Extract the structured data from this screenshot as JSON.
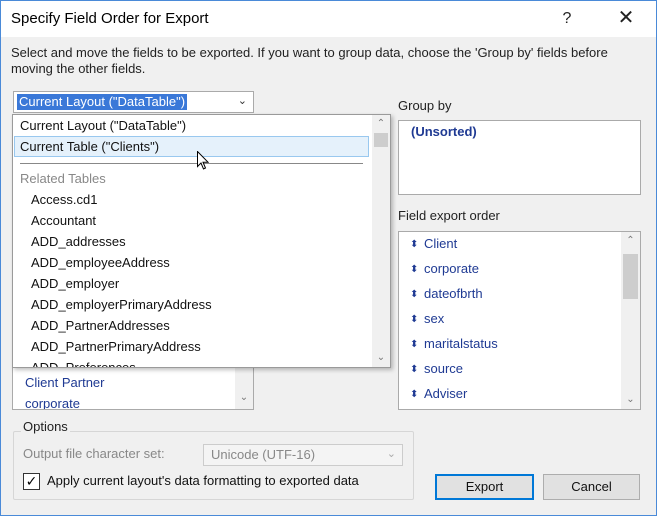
{
  "window": {
    "title": "Specify Field Order for Export",
    "help_label": "?",
    "close_label": "✕"
  },
  "instructions": "Select and move the fields to be exported. If you want to group data, choose the 'Group by' fields before moving the other fields.",
  "source_combo": {
    "value": "Current Layout (\"DataTable\")",
    "arrow": "⌄"
  },
  "dropdown": {
    "items": [
      "Current Layout (\"DataTable\")",
      "Current Table (\"Clients\")"
    ],
    "group_label": "Related Tables",
    "related_tables": [
      "Access.cd1",
      "Accountant",
      "ADD_addresses",
      "ADD_employeeAddress",
      "ADD_employer",
      "ADD_employerPrimaryAddress",
      "ADD_PartnerAddresses",
      "ADD_PartnerPrimaryAddress",
      "ADD_Preferences"
    ]
  },
  "fields_list": {
    "items": [
      "Client Partner",
      "corporate"
    ]
  },
  "group_by": {
    "label": "Group by",
    "items": [
      "(Unsorted)"
    ]
  },
  "field_export_order": {
    "label": "Field export order",
    "items": [
      "Client",
      "corporate",
      "dateofbrth",
      "sex",
      "maritalstatus",
      "source",
      "Adviser"
    ]
  },
  "options": {
    "legend": "Options",
    "charset_label": "Output file character set:",
    "charset_value": "Unicode (UTF-16)",
    "apply_formatting_label": "Apply current layout's data formatting to exported data",
    "apply_formatting_checked": true
  },
  "buttons": {
    "export": "Export",
    "cancel": "Cancel"
  },
  "icons": {
    "drag_handle": "⬍",
    "scroll_up": "⌃",
    "scroll_down": "⌄",
    "check": "✓"
  },
  "colors": {
    "accent": "#3a78d8",
    "field_text": "#1f3a93",
    "hover_bg": "#e5f1fb",
    "primary_border": "#0078d7"
  }
}
